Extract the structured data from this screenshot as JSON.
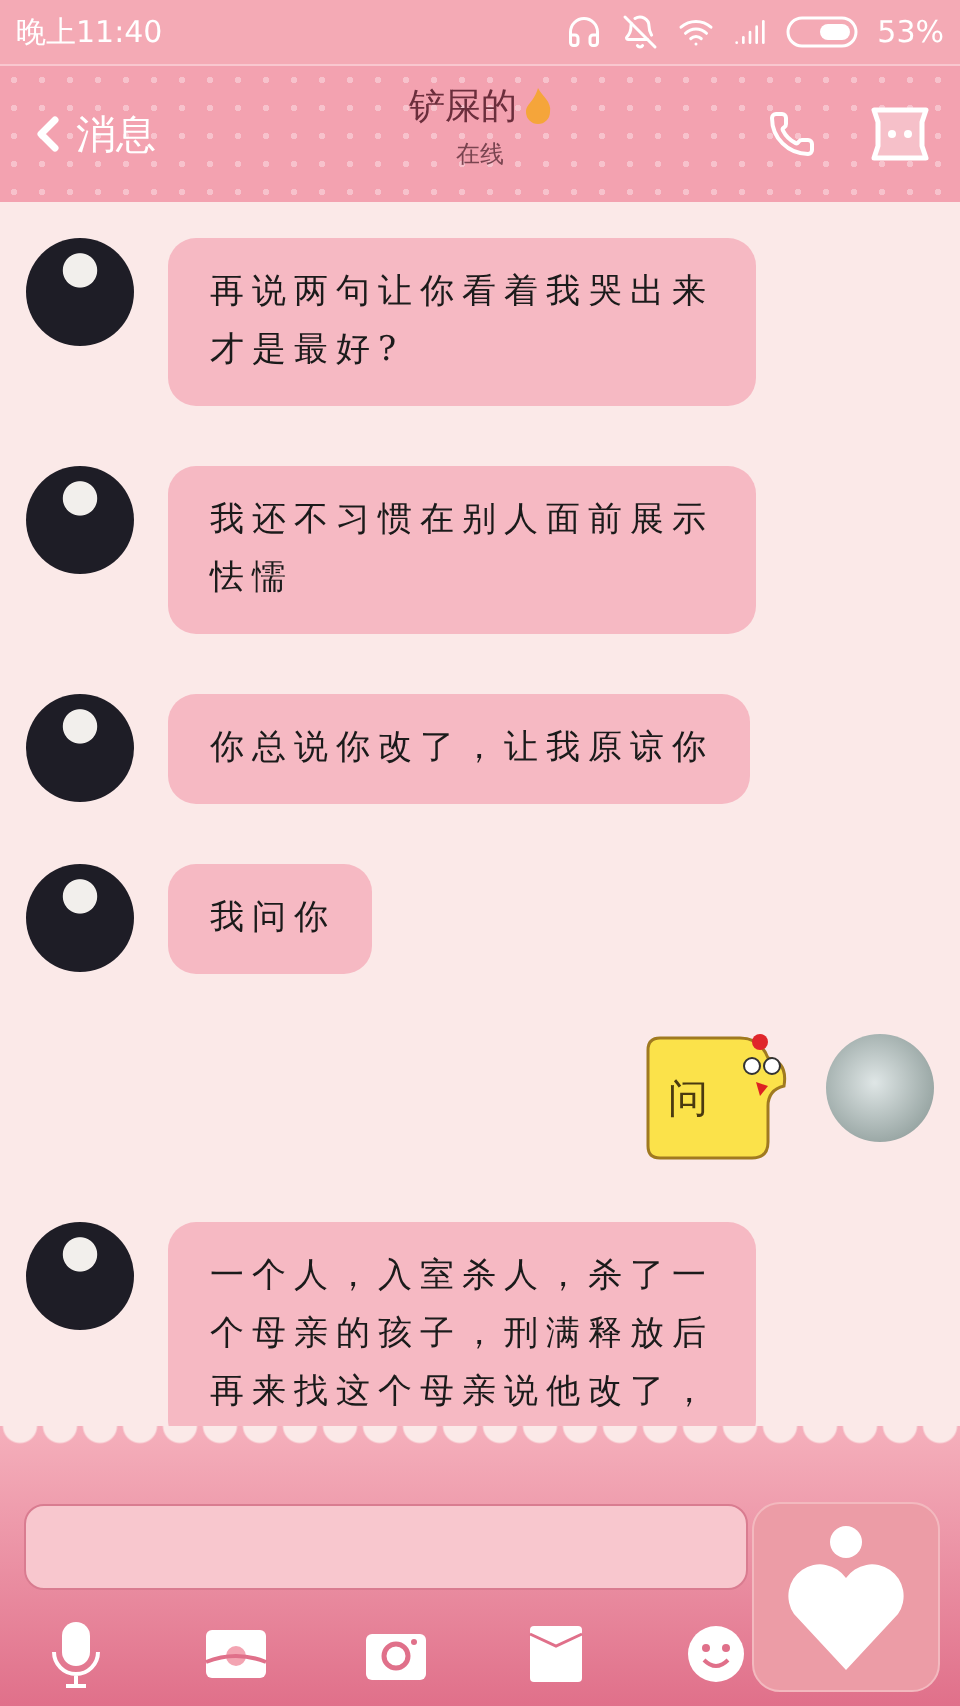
{
  "status_bar": {
    "time": "晚上11:40",
    "battery": "53%"
  },
  "header": {
    "back": "消息",
    "title": "铲屎的",
    "presence": "在线"
  },
  "messages": [
    {
      "kind": "text",
      "outgoing": false,
      "text": "再说两句让你看着我哭出来才是最好?"
    },
    {
      "kind": "text",
      "outgoing": false,
      "text": "我还不习惯在别人面前展示怯懦"
    },
    {
      "kind": "text",
      "outgoing": false,
      "text": "你总说你改了，让我原谅你"
    },
    {
      "kind": "text",
      "outgoing": false,
      "text": "我问你"
    },
    {
      "kind": "sticker",
      "outgoing": true,
      "text": "问"
    },
    {
      "kind": "text",
      "outgoing": false,
      "text": "一个人，入室杀人，杀了一个母亲的孩子，刑满释放后再来找这个母亲说他改了，"
    }
  ]
}
